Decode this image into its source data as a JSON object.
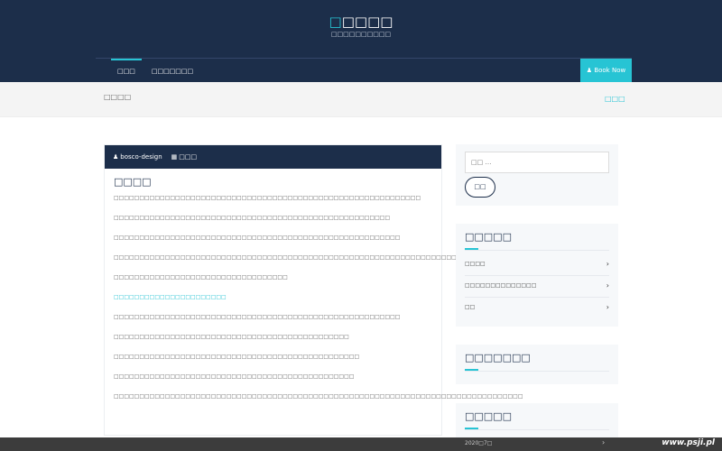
{
  "site": {
    "title_first": "□",
    "title_rest": "□□□□",
    "tagline": "□□□□□□□□□□"
  },
  "nav": {
    "items": [
      {
        "label": "□□□",
        "active": true
      },
      {
        "label": "□□□□□□□",
        "active": false
      }
    ],
    "book_label": "Book Now"
  },
  "breadcrumb": {
    "title": "□□□□",
    "home": "□□□"
  },
  "post": {
    "author": "bosco-design",
    "category": "□□□",
    "title": "□□□□",
    "paragraphs": [
      "□□□□□□□□□□□□□□□□□□□□□□□□□□□□□□□□□□□□□□□□□□□□□□□□□□□□□□□□□□□□",
      "□□□□□□□□□□□□□□□□□□□□□□□□□□□□□□□□□□□□□□□□□□□□□□□□□□□□□□",
      "□□□□□□□□□□□□□□□□□□□□□□□□□□□□□□□□□□□□□□□□□□□□□□□□□□□□□□□□",
      "□□□□□□□□□□□□□□□□□□□□□□□□□□□□□□□□□□□□□□□□□□□□□□□□□□□□□□□□□□□□□□□□□□□□□□□□□□□□□□□□□□□□",
      "□□□□□□□□□□□□□□□□□□□□□□□□□□□□□□□□□□",
      "□□□□□□□□□□□□□□□□□□□□□□",
      "□□□□□□□□□□□□□□□□□□□□□□□□□□□□□□□□□□□□□□□□□□□□□□□□□□□□□□□□",
      "□□□□□□□□□□□□□□□□□□□□□□□□□□□□□□□□□□□□□□□□□□□□□□",
      "□□□□□□□□□□□□□□□□□□□□□□□□□□□□□□□□□□□□□□□□□□□□□□□□",
      "□□□□□□□□□□□□□□□□□□□□□□□□□□□□□□□□□□□□□□□□□□□□□□□",
      "□□□□□□□□□□□□□□□□□□□□□□□□□□□□□□□□□□□□□□□□□□□□□□□□□□□□□□□□□□□□□□□□□□□□□□□□□□□□□□□□"
    ],
    "link_index": 5
  },
  "sidebar": {
    "search_placeholder": "□□ …",
    "search_button": "□□",
    "widget1": {
      "title": "□□□□□",
      "items": [
        "□□□□",
        "□□□□□□□□□□□□□□",
        "□□"
      ]
    },
    "widget2": {
      "title": "□□□□□□□"
    },
    "widget3": {
      "title": "□□□□□",
      "first_item": "2020□7□"
    }
  },
  "watermark": "www.psji.pl",
  "colors": {
    "navy": "#1c2e4a",
    "accent": "#27c4d4"
  }
}
